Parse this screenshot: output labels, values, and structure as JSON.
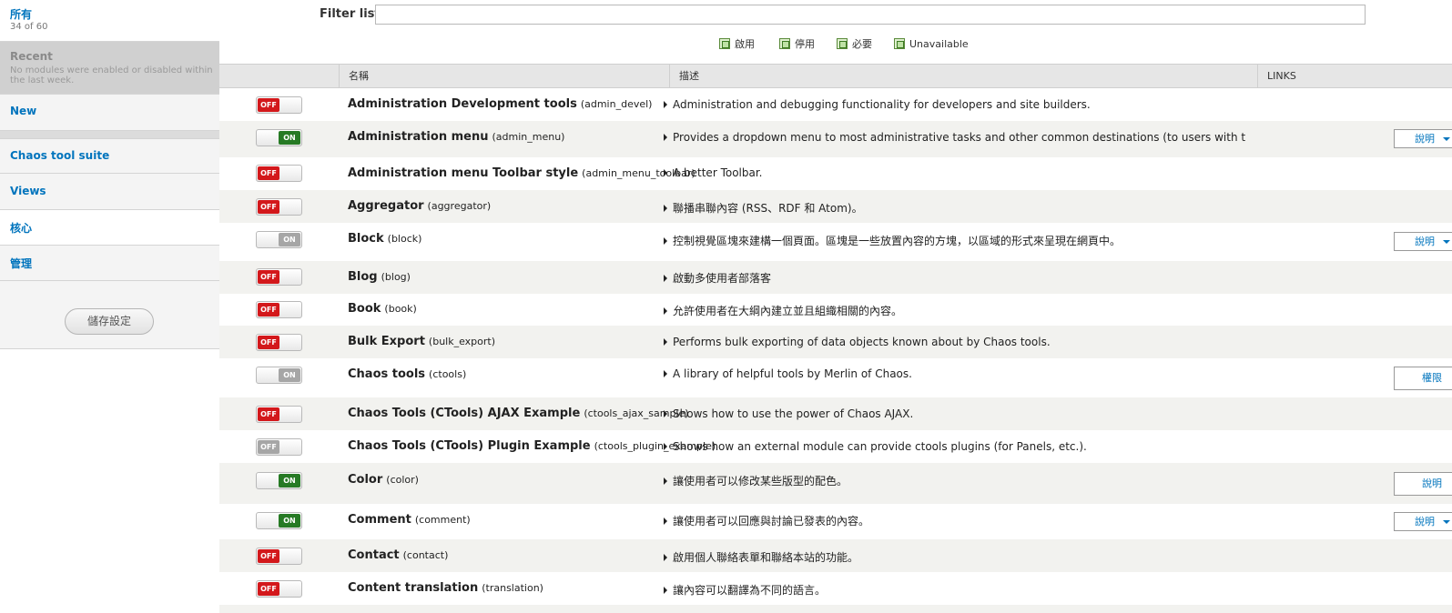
{
  "sidebar": {
    "all": {
      "label": "所有",
      "count": "34 of 60"
    },
    "recent": {
      "label": "Recent",
      "note": "No modules were enabled or disabled within the last week."
    },
    "new": {
      "label": "New"
    },
    "ctools": {
      "label": "Chaos tool suite"
    },
    "views": {
      "label": "Views"
    },
    "core": {
      "label": "核心"
    },
    "manage": {
      "label": "管理"
    },
    "save_label": "儲存設定"
  },
  "filter": {
    "label": "Filter list",
    "value": ""
  },
  "legend": {
    "enabled": "啟用",
    "disabled": "停用",
    "required": "必要",
    "unavailable": "Unavailable"
  },
  "table": {
    "headers": {
      "name": "名稱",
      "desc": "描述",
      "links": "LINKS"
    },
    "rows": [
      {
        "state": "off",
        "toggle": "OFF",
        "name": "Administration Development tools",
        "machine": "(admin_devel)",
        "desc": "Administration and debugging functionality for developers and site builders.",
        "link": ""
      },
      {
        "state": "on",
        "toggle": "ON",
        "name": "Administration menu",
        "machine": "(admin_menu)",
        "desc": "Provides a dropdown menu to most administrative tasks and other common destinations (to users with the proper …",
        "link": "說明"
      },
      {
        "state": "off",
        "toggle": "OFF",
        "name": "Administration menu Toolbar style",
        "machine": "(admin_menu_toolbar)",
        "desc": "A better Toolbar.",
        "link": ""
      },
      {
        "state": "off",
        "toggle": "OFF",
        "name": "Aggregator",
        "machine": "(aggregator)",
        "desc": "聯播串聯內容 (RSS、RDF 和 Atom)。",
        "link": ""
      },
      {
        "state": "dis-on",
        "toggle": "ON",
        "name": "Block",
        "machine": "(block)",
        "desc": "控制視覺區塊來建構一個頁面。區塊是一些放置內容的方塊，以區域的形式來呈現在網頁中。",
        "link": "說明"
      },
      {
        "state": "off",
        "toggle": "OFF",
        "name": "Blog",
        "machine": "(blog)",
        "desc": "啟動多使用者部落客",
        "link": ""
      },
      {
        "state": "off",
        "toggle": "OFF",
        "name": "Book",
        "machine": "(book)",
        "desc": "允許使用者在大綱內建立並且組織相關的內容。",
        "link": ""
      },
      {
        "state": "off",
        "toggle": "OFF",
        "name": "Bulk Export",
        "machine": "(bulk_export)",
        "desc": "Performs bulk exporting of data objects known about by Chaos tools.",
        "link": ""
      },
      {
        "state": "dis-on",
        "toggle": "ON",
        "name": "Chaos tools",
        "machine": "(ctools)",
        "desc": "A library of helpful tools by Merlin of Chaos.",
        "link": "權限"
      },
      {
        "state": "off",
        "toggle": "OFF",
        "name": "Chaos Tools (CTools) AJAX Example",
        "machine": "(ctools_ajax_sample)",
        "desc": "Shows how to use the power of Chaos AJAX.",
        "link": ""
      },
      {
        "state": "dis-off",
        "toggle": "OFF",
        "name": "Chaos Tools (CTools) Plugin Example",
        "machine": "(ctools_plugin_example)",
        "desc": "Shows how an external module can provide ctools plugins (for Panels, etc.).",
        "link": ""
      },
      {
        "state": "on",
        "toggle": "ON",
        "name": "Color",
        "machine": "(color)",
        "desc": "讓使用者可以修改某些版型的配色。",
        "link": "說明"
      },
      {
        "state": "on",
        "toggle": "ON",
        "name": "Comment",
        "machine": "(comment)",
        "desc": "讓使用者可以回應與討論已發表的內容。",
        "link": "說明"
      },
      {
        "state": "off",
        "toggle": "OFF",
        "name": "Contact",
        "machine": "(contact)",
        "desc": "啟用個人聯絡表單和聯絡本站的功能。",
        "link": ""
      },
      {
        "state": "off",
        "toggle": "OFF",
        "name": "Content translation",
        "machine": "(translation)",
        "desc": "讓內容可以翻譯為不同的語言。",
        "link": ""
      }
    ]
  }
}
